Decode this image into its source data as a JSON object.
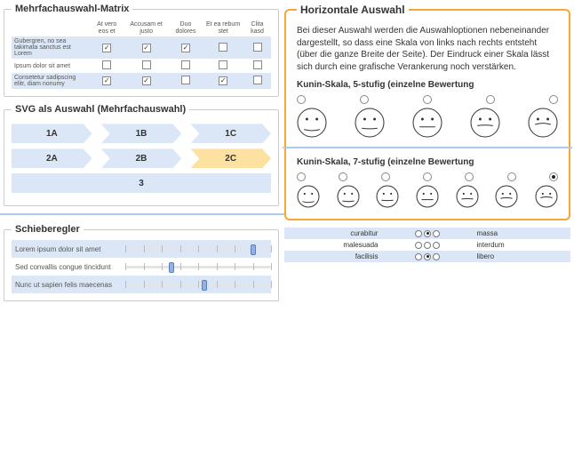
{
  "matrix": {
    "title": "Mehrfachauswahl-Matrix",
    "cols": [
      "At vero eos et",
      "Accusam et justo",
      "Duo dolores",
      "Et ea rebum stet",
      "Clita kasd"
    ],
    "rows": [
      {
        "label": "Gubergren, no sea takimata sanctus est Lorem",
        "vals": [
          true,
          true,
          true,
          false,
          false
        ]
      },
      {
        "label": "Ipsum dolor sit amet",
        "vals": [
          false,
          false,
          false,
          false,
          false
        ]
      },
      {
        "label": "Consetetur sadipscing elitr, diam nonumy",
        "vals": [
          true,
          true,
          false,
          true,
          false
        ]
      }
    ]
  },
  "svgsel": {
    "title": "SVG als Auswahl (Mehrfachauswahl)",
    "rows": [
      [
        "1A",
        "1B",
        "1C"
      ],
      [
        "2A",
        "2B",
        "2C"
      ]
    ],
    "full": "3",
    "selected": "2C"
  },
  "sliders": {
    "title": "Schieberegler",
    "items": [
      {
        "label": "Lorem ipsum dolor sit amet",
        "pos": 0.88
      },
      {
        "label": "Sed convallis congue tincidunt",
        "pos": 0.32
      },
      {
        "label": "Nunc ut sapien felis maecenas",
        "pos": 0.54
      }
    ]
  },
  "horiz": {
    "title": "Horizontale Auswahl",
    "desc": "Bei dieser Auswahl werden die Auswahloptionen nebeneinander dargestellt, so dass eine Skala von links nach rechts entsteht (über die ganze Breite der Seite). Der Eindruck einer Skala lässt sich durch eine grafische Verankerung noch verstärken.",
    "kunin5": {
      "title": "Kunin-Skala, 5-stufig (einzelne Bewertung",
      "count": 5,
      "selected": -1
    },
    "kunin7": {
      "title": "Kunin-Skala, 7-stufig (einzelne Bewertung",
      "count": 7,
      "selected": 6
    }
  },
  "mini": {
    "rows": [
      {
        "left": "curabitur",
        "sel": 1,
        "right": "massa"
      },
      {
        "left": "malesuada",
        "sel": -1,
        "right": "interdum"
      },
      {
        "left": "facilisis",
        "sel": 1,
        "right": "libero"
      }
    ]
  }
}
